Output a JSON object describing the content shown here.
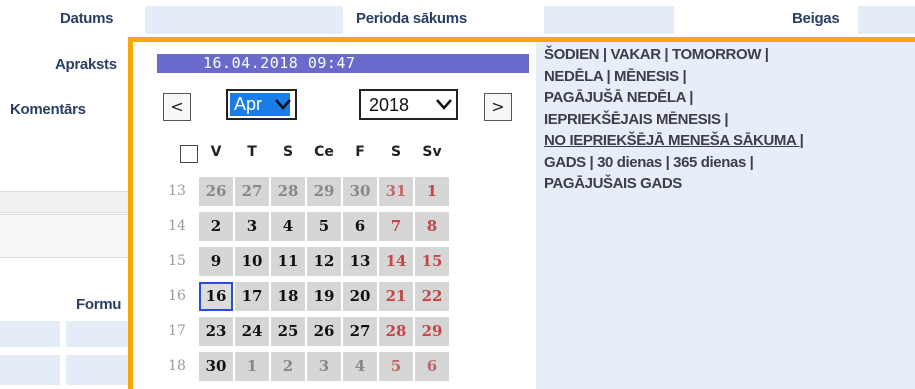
{
  "form": {
    "labels": {
      "datums": "Datums",
      "perioda_sakums": "Perioda sākums",
      "beigas": "Beigas",
      "apraksts": "Apraksts",
      "komentars": "Komentārs",
      "forma": "Formu"
    }
  },
  "datepicker": {
    "current_datetime": "16.04.2018 09:47",
    "prev_label": "<",
    "next_label": ">",
    "month_select": "Apr",
    "year_select": "2018",
    "weekday_headers": [
      "V",
      "T",
      "S",
      "Ce",
      "F",
      "S",
      "Sv"
    ],
    "weeks": [
      {
        "num": "13",
        "days": [
          "26",
          "27",
          "28",
          "29",
          "30",
          "31",
          "1"
        ]
      },
      {
        "num": "14",
        "days": [
          "2",
          "3",
          "4",
          "5",
          "6",
          "7",
          "8"
        ]
      },
      {
        "num": "15",
        "days": [
          "9",
          "10",
          "11",
          "12",
          "13",
          "14",
          "15"
        ]
      },
      {
        "num": "16",
        "days": [
          "16",
          "17",
          "18",
          "19",
          "20",
          "21",
          "22"
        ]
      },
      {
        "num": "17",
        "days": [
          "23",
          "24",
          "25",
          "26",
          "27",
          "28",
          "29"
        ]
      },
      {
        "num": "18",
        "days": [
          "30",
          "1",
          "2",
          "3",
          "4",
          "5",
          "6"
        ]
      }
    ],
    "selected_day": "16"
  },
  "shortcuts": {
    "lines": [
      "ŠODIEN | VAKAR | TOMORROW |",
      "NEDĒLA | MĒNESIS |",
      "PAGĀJUŠĀ NEDĒLA |",
      "IEPRIEKŠĒJAIS MĒNESIS |",
      "NO IEPRIEKŠĒJĀ MENEŠA SĀKUMA |",
      "GADS | 30 dienas | 365 dienas |",
      "PAGĀJUŠAIS GADS"
    ]
  },
  "colors": {
    "accent_border": "#f5a800",
    "datetime_bar": "#6a6acd",
    "weekend_text": "#c04848",
    "today_outline": "#2a4be0"
  }
}
